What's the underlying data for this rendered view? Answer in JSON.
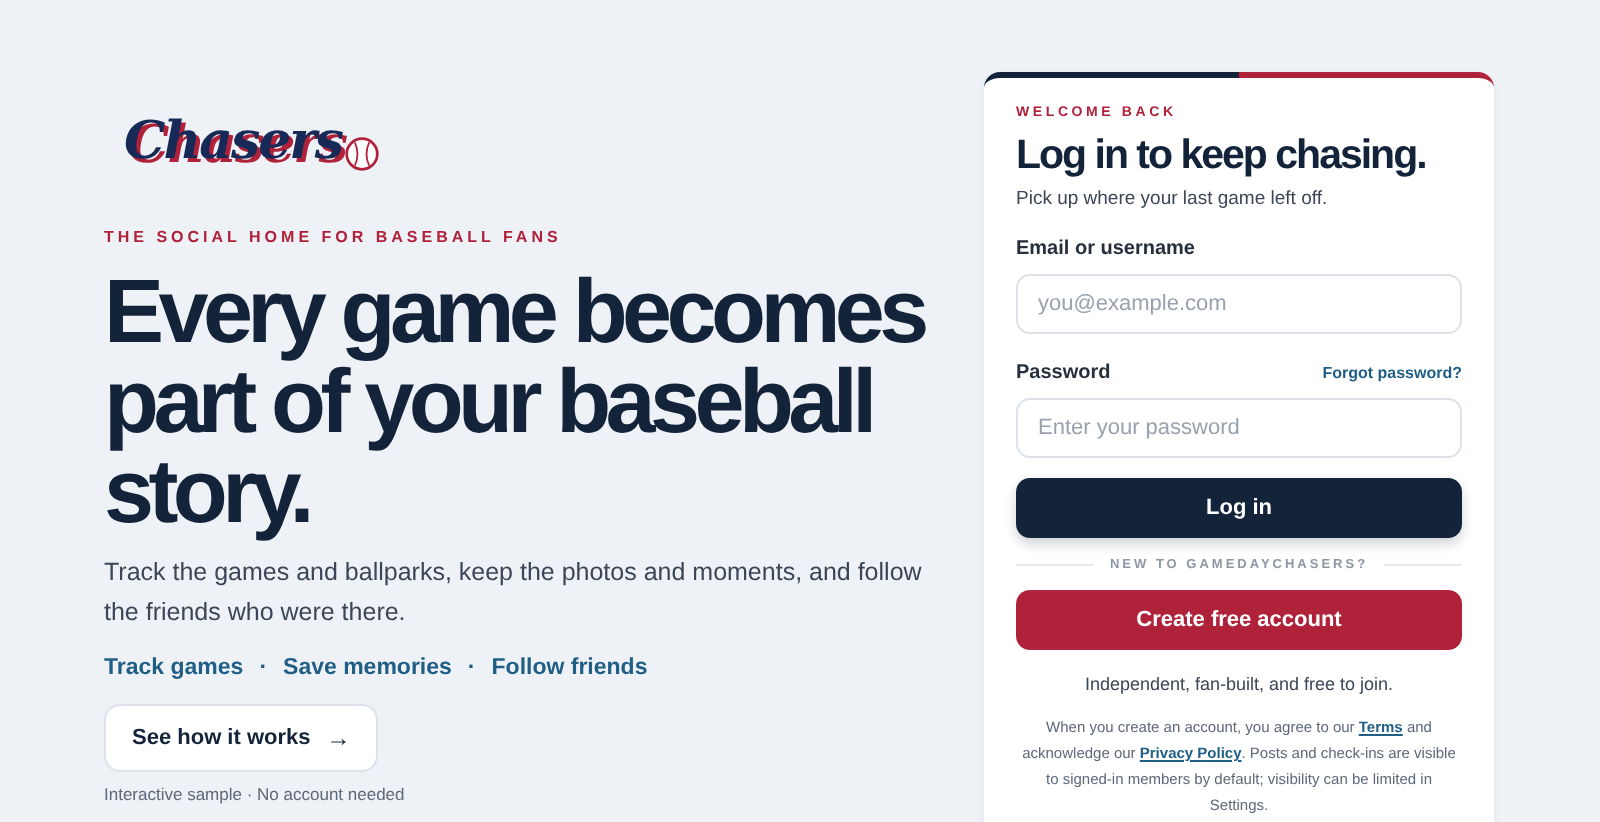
{
  "brand": {
    "logo_text": "Chasers"
  },
  "hero": {
    "eyebrow": "THE SOCIAL HOME FOR BASEBALL FANS",
    "heading": "Every game becomes part of your baseball story.",
    "intro": "Track the games and ballparks, keep the photos and moments, and follow the friends who were there.",
    "highlights": [
      "Track games",
      "Save memories",
      "Follow friends"
    ],
    "highlight_separator": "·",
    "cta": {
      "label": "See how it works",
      "icon": "→"
    },
    "cta_note": "Interactive sample · No account needed"
  },
  "login": {
    "eyebrow": "WELCOME BACK",
    "title": "Log in to keep chasing.",
    "subtitle": "Pick up where your last game left off.",
    "fields": [
      {
        "label": "Email or username",
        "placeholder": "you@example.com"
      },
      {
        "label": "Password",
        "placeholder": "Enter your password",
        "aside": "Forgot password?"
      }
    ],
    "submit": "Log in",
    "divider": "NEW TO GAMEDAYCHASERS?",
    "create": "Create free account",
    "tagline": "Independent, fan-built, and free to join.",
    "legal": [
      {
        "kind": "text",
        "text": "When you create an account, you agree to our "
      },
      {
        "kind": "link",
        "text": "Terms"
      },
      {
        "kind": "text",
        "text": " and acknowledge our "
      },
      {
        "kind": "link",
        "text": "Privacy Policy"
      },
      {
        "kind": "text",
        "text": ". Posts and check-ins are visible to signed-in members by default; visibility can be limited in Settings."
      }
    ]
  }
}
